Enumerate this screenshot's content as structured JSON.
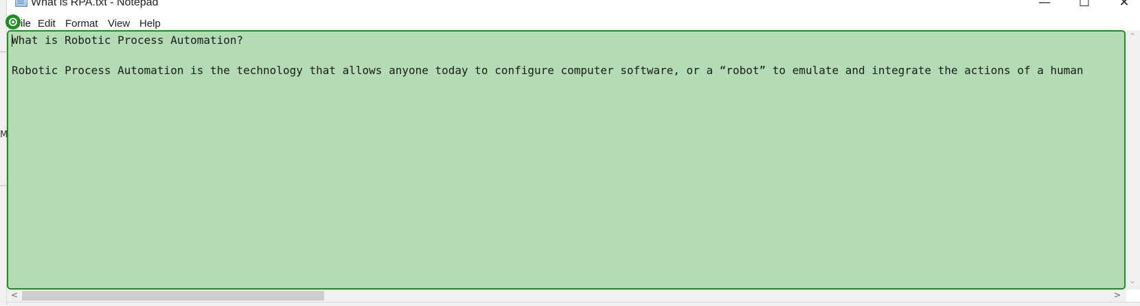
{
  "window": {
    "title": "What is RPA.txt - Notepad",
    "controls": {
      "minimize": "—",
      "maximize": "☐",
      "close": "✕"
    }
  },
  "menu": {
    "items": [
      {
        "id": "file",
        "label": "ile"
      },
      {
        "id": "edit",
        "label": "Edit"
      },
      {
        "id": "format",
        "label": "Format"
      },
      {
        "id": "view",
        "label": "View"
      },
      {
        "id": "help",
        "label": "Help"
      }
    ]
  },
  "editor": {
    "lines": [
      "What is Robotic Process Automation?",
      "",
      "Robotic Process Automation is the technology that allows anyone today to configure computer software, or a “robot” to emulate and integrate the actions of a human"
    ],
    "highlight_color": "#b3dcb5",
    "highlight_border": "#1b8f22"
  },
  "background_window": {
    "edge_glyph": "M"
  },
  "scrollbars": {
    "left_arrow": "<",
    "right_arrow": ">",
    "up_arrow": "⌃",
    "down_arrow": "⌄"
  }
}
